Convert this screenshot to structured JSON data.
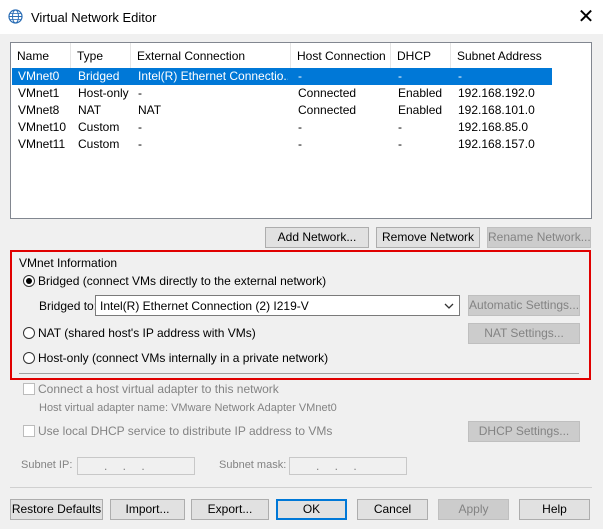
{
  "window": {
    "title": "Virtual Network Editor",
    "close_glyph": "✕"
  },
  "table": {
    "headers": [
      "Name",
      "Type",
      "External Connection",
      "Host Connection",
      "DHCP",
      "Subnet Address"
    ],
    "rows": [
      [
        "VMnet0",
        "Bridged",
        "Intel(R) Ethernet Connectio...",
        "-",
        "-",
        "-"
      ],
      [
        "VMnet1",
        "Host-only",
        "-",
        "Connected",
        "Enabled",
        "192.168.192.0"
      ],
      [
        "VMnet8",
        "NAT",
        "NAT",
        "Connected",
        "Enabled",
        "192.168.101.0"
      ],
      [
        "VMnet10",
        "Custom",
        "-",
        "-",
        "-",
        "192.168.85.0"
      ],
      [
        "VMnet11",
        "Custom",
        "-",
        "-",
        "-",
        "192.168.157.0"
      ]
    ],
    "selected_row": 0
  },
  "list_buttons": {
    "add": "Add Network...",
    "remove": "Remove Network",
    "rename": "Rename Network..."
  },
  "vmnet_info": {
    "group_label": "VMnet Information",
    "bridged_label": "Bridged (connect VMs directly to the external network)",
    "bridged_to_label": "Bridged to:",
    "bridged_to_value": "Intel(R) Ethernet Connection (2) I219-V",
    "auto_settings": "Automatic Settings...",
    "nat_label": "NAT (shared host's IP address with VMs)",
    "nat_settings": "NAT Settings...",
    "hostonly_label": "Host-only (connect VMs internally in a private network)",
    "selected_mode": "bridged"
  },
  "host_adapter": {
    "connect_label": "Connect a host virtual adapter to this network",
    "adapter_name_label": "Host virtual adapter name: VMware Network Adapter VMnet0"
  },
  "dhcp": {
    "use_label": "Use local DHCP service to distribute IP address to VMs",
    "settings": "DHCP Settings..."
  },
  "subnet": {
    "ip_label": "Subnet IP:",
    "mask_label": "Subnet mask:",
    "ip_value": " .  .  . ",
    "mask_value": " .  .  . "
  },
  "footer": {
    "restore": "Restore Defaults",
    "import": "Import...",
    "export": "Export...",
    "ok": "OK",
    "cancel": "Cancel",
    "apply": "Apply",
    "help": "Help"
  },
  "colors": {
    "selection": "#0078d7",
    "highlight_box": "#e00000"
  }
}
